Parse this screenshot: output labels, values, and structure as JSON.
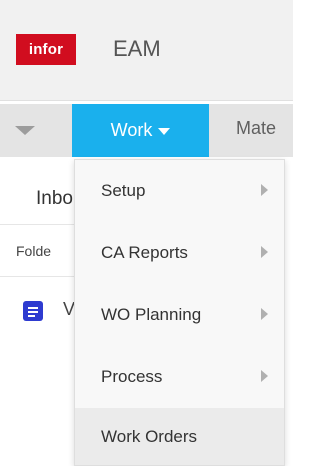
{
  "header": {
    "logo_text": "infor",
    "app_title": "EAM"
  },
  "navbar": {
    "active_tab": "Work",
    "next_tab": "Mate"
  },
  "content": {
    "inbox_title": "Inbo",
    "folder_column": "Folde",
    "row_text": "V"
  },
  "dropdown": {
    "items": [
      {
        "label": "Setup",
        "has_submenu": true
      },
      {
        "label": "CA Reports",
        "has_submenu": true
      },
      {
        "label": "WO Planning",
        "has_submenu": true
      },
      {
        "label": "Process",
        "has_submenu": true
      },
      {
        "label": "Work Orders",
        "has_submenu": false
      }
    ]
  },
  "colors": {
    "brand_red": "#d10d1f",
    "accent_blue": "#1ab0ed",
    "row_icon": "#2e3bd0"
  }
}
